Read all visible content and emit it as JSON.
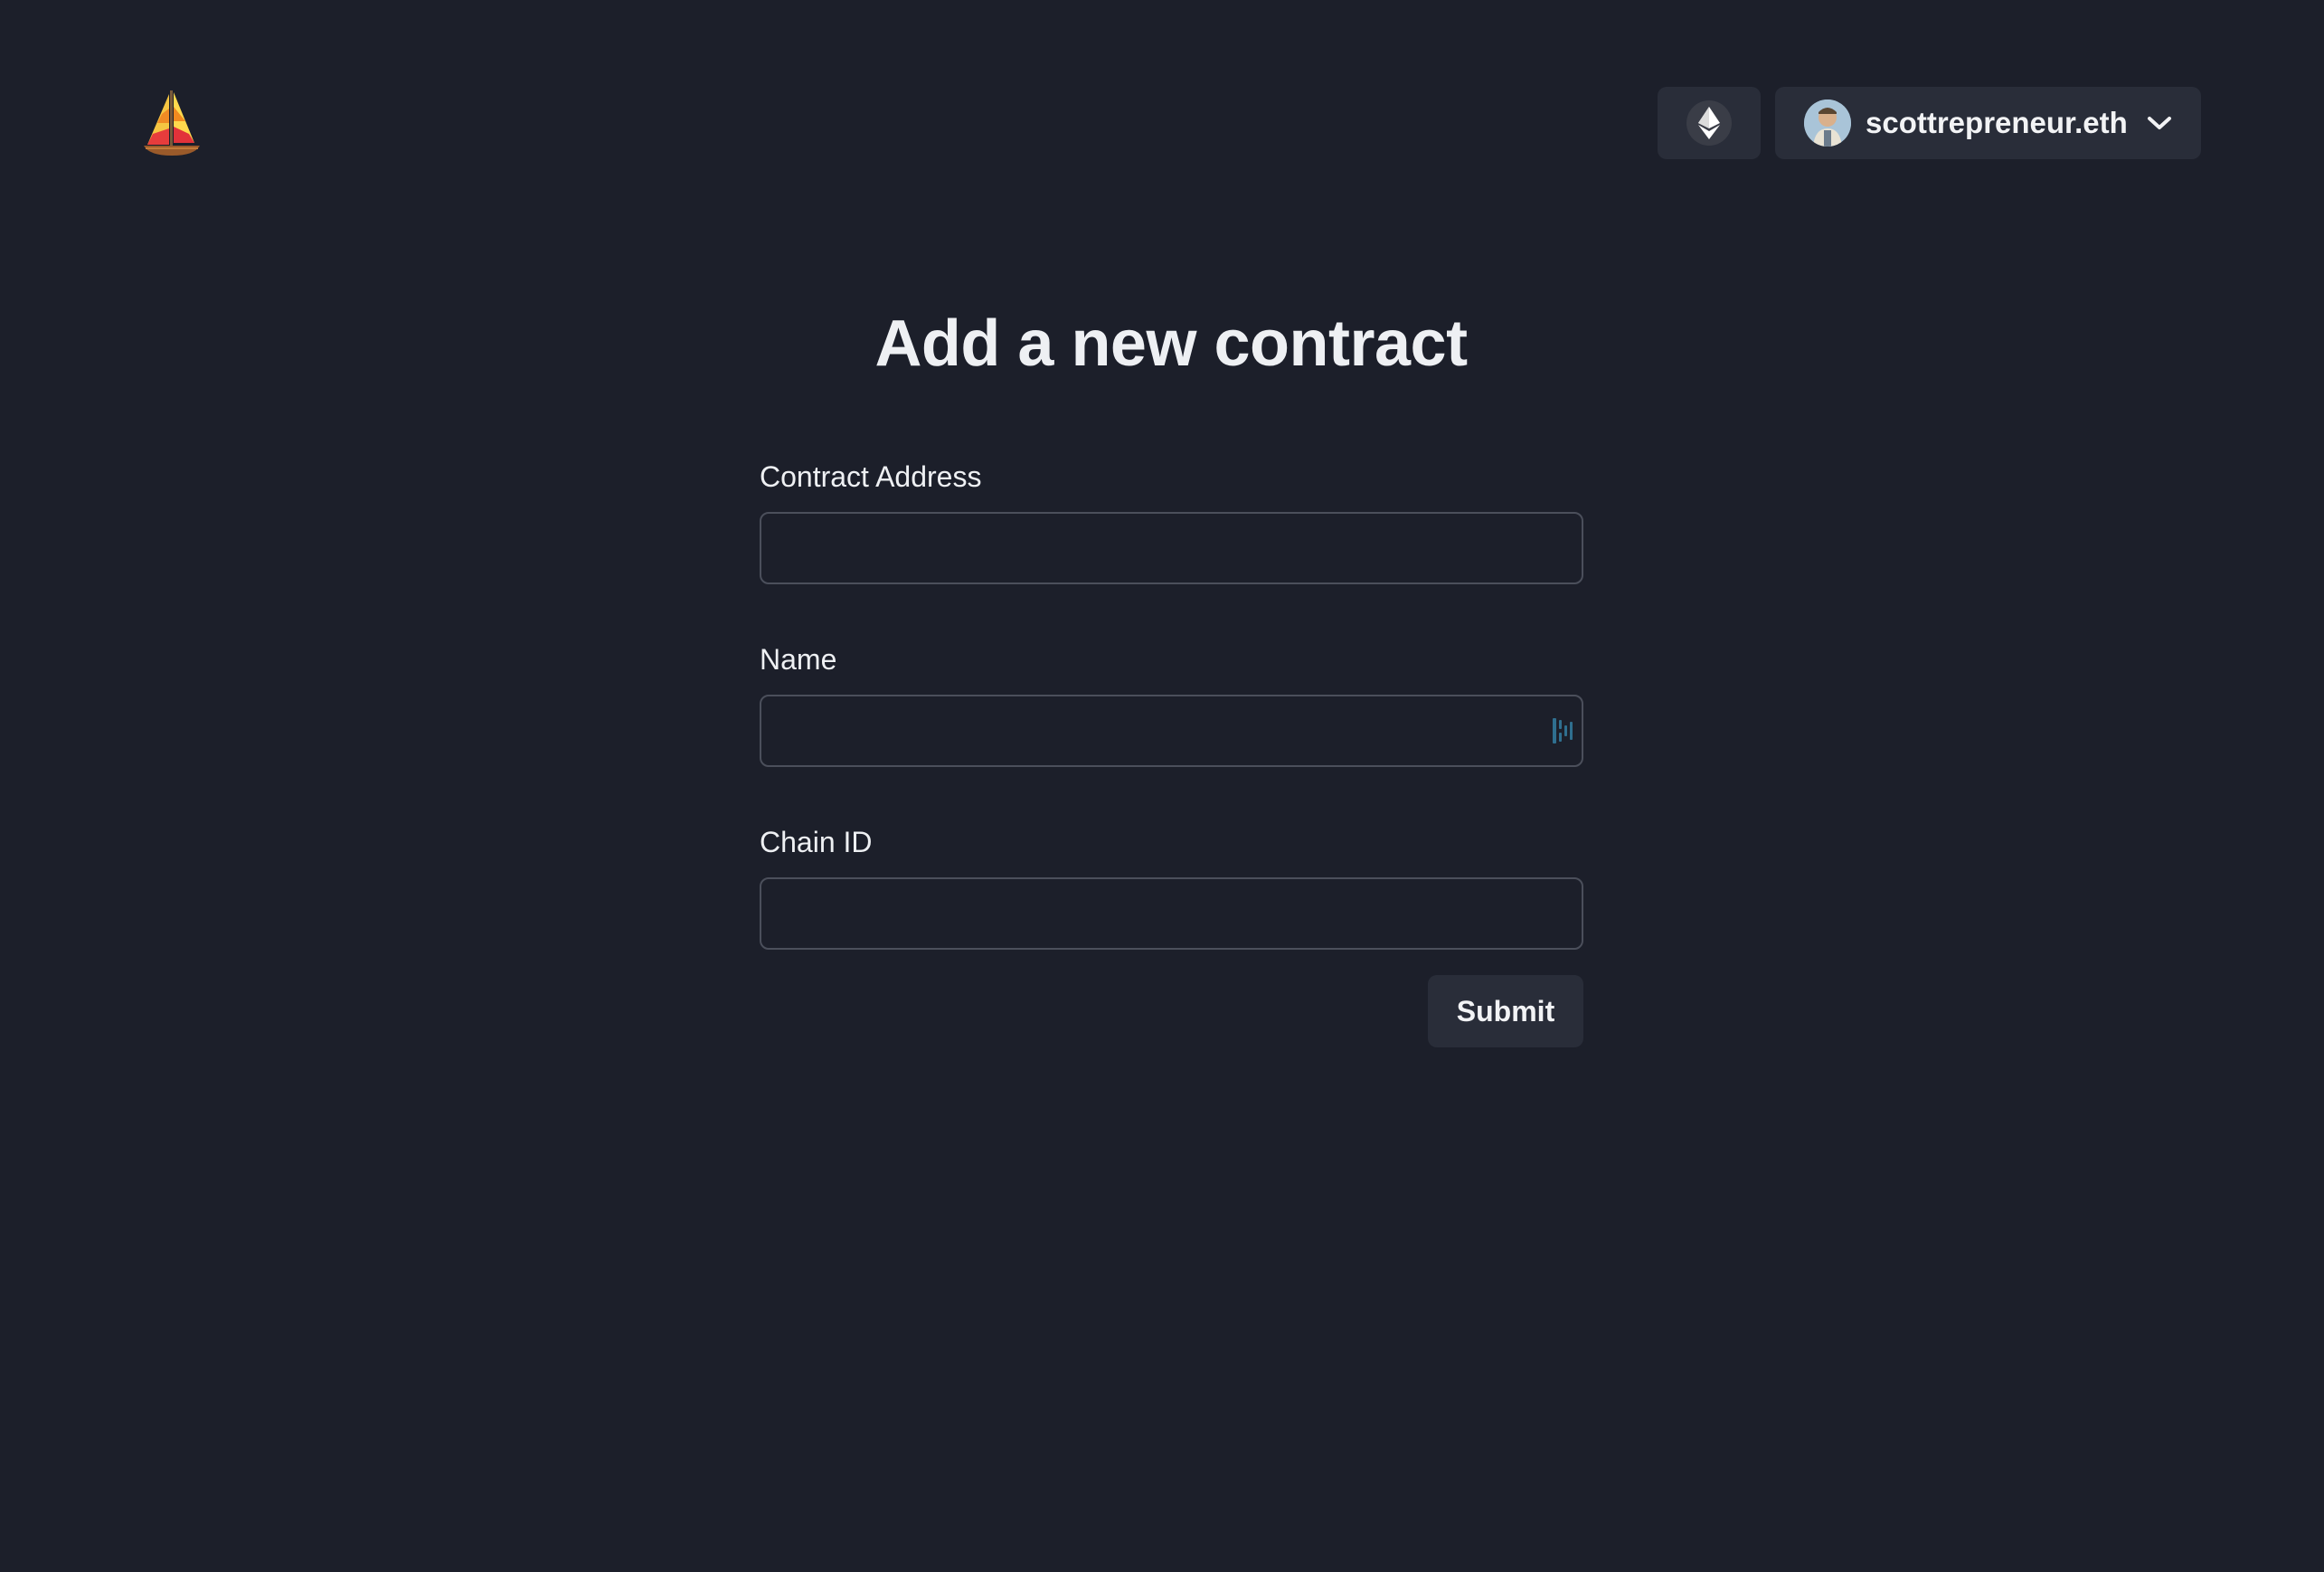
{
  "header": {
    "logo_icon": "sailboat-icon",
    "chain_icon": "ethereum-icon",
    "account": {
      "name": "scottrepreneur.eth",
      "avatar_icon": "avatar-image",
      "dropdown_icon": "chevron-down-icon"
    }
  },
  "main": {
    "title": "Add a new contract",
    "fields": [
      {
        "label": "Contract Address",
        "value": "",
        "placeholder": ""
      },
      {
        "label": "Name",
        "value": "",
        "placeholder": "",
        "extension_icon": "password-manager-icon"
      },
      {
        "label": "Chain ID",
        "value": "",
        "placeholder": ""
      }
    ],
    "submit_label": "Submit"
  },
  "colors": {
    "background": "#1c1f2a",
    "button_bg": "#292d39",
    "input_border": "#4b4f5b",
    "text": "#f2f3f5"
  }
}
